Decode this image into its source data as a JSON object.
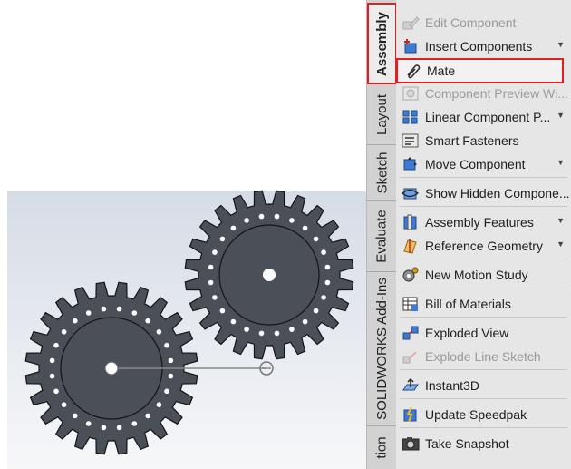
{
  "tabs": [
    {
      "label": "Assembly",
      "active": true
    },
    {
      "label": "Layout",
      "active": false
    },
    {
      "label": "Sketch",
      "active": false
    },
    {
      "label": "Evaluate",
      "active": false
    },
    {
      "label": "SOLIDWORKS Add-Ins",
      "active": false
    },
    {
      "label": "tion",
      "active": false
    }
  ],
  "commands": [
    {
      "label": "Edit Component",
      "icon": "edit-component-icon",
      "disabled": true,
      "dropdown": false
    },
    {
      "label": "Insert Components",
      "icon": "insert-components-icon",
      "disabled": false,
      "dropdown": true
    },
    {
      "label": "Mate",
      "icon": "paperclip-icon",
      "disabled": false,
      "dropdown": false,
      "selected": true
    },
    {
      "label": "Component Preview Wi...",
      "icon": "component-preview-icon",
      "disabled": true,
      "dropdown": false
    },
    {
      "label": "Linear Component P...",
      "icon": "linear-pattern-icon",
      "disabled": false,
      "dropdown": true
    },
    {
      "label": "Smart Fasteners",
      "icon": "smart-fasteners-icon",
      "disabled": false,
      "dropdown": false
    },
    {
      "label": "Move Component",
      "icon": "move-component-icon",
      "disabled": false,
      "dropdown": true
    },
    {
      "label": "Show Hidden Compone...",
      "icon": "show-hidden-icon",
      "disabled": false,
      "dropdown": false
    },
    {
      "label": "Assembly Features",
      "icon": "assembly-features-icon",
      "disabled": false,
      "dropdown": true
    },
    {
      "label": "Reference Geometry",
      "icon": "reference-geometry-icon",
      "disabled": false,
      "dropdown": true
    },
    {
      "label": "New Motion Study",
      "icon": "motion-study-icon",
      "disabled": false,
      "dropdown": false
    },
    {
      "label": "Bill of Materials",
      "icon": "bill-of-materials-icon",
      "disabled": false,
      "dropdown": false
    },
    {
      "label": "Exploded View",
      "icon": "exploded-view-icon",
      "disabled": false,
      "dropdown": false
    },
    {
      "label": "Explode Line Sketch",
      "icon": "explode-line-sketch-icon",
      "disabled": true,
      "dropdown": false
    },
    {
      "label": "Instant3D",
      "icon": "instant3d-icon",
      "disabled": false,
      "dropdown": false
    },
    {
      "label": "Update Speedpak",
      "icon": "speedpak-icon",
      "disabled": false,
      "dropdown": false
    },
    {
      "label": "Take Snapshot",
      "icon": "camera-icon",
      "disabled": false,
      "dropdown": false
    }
  ],
  "colors": {
    "gear_fill": "#4a4f58",
    "gear_stroke": "#141414",
    "highlight": "#e02020",
    "panel_bg": "#e6e6e6"
  }
}
